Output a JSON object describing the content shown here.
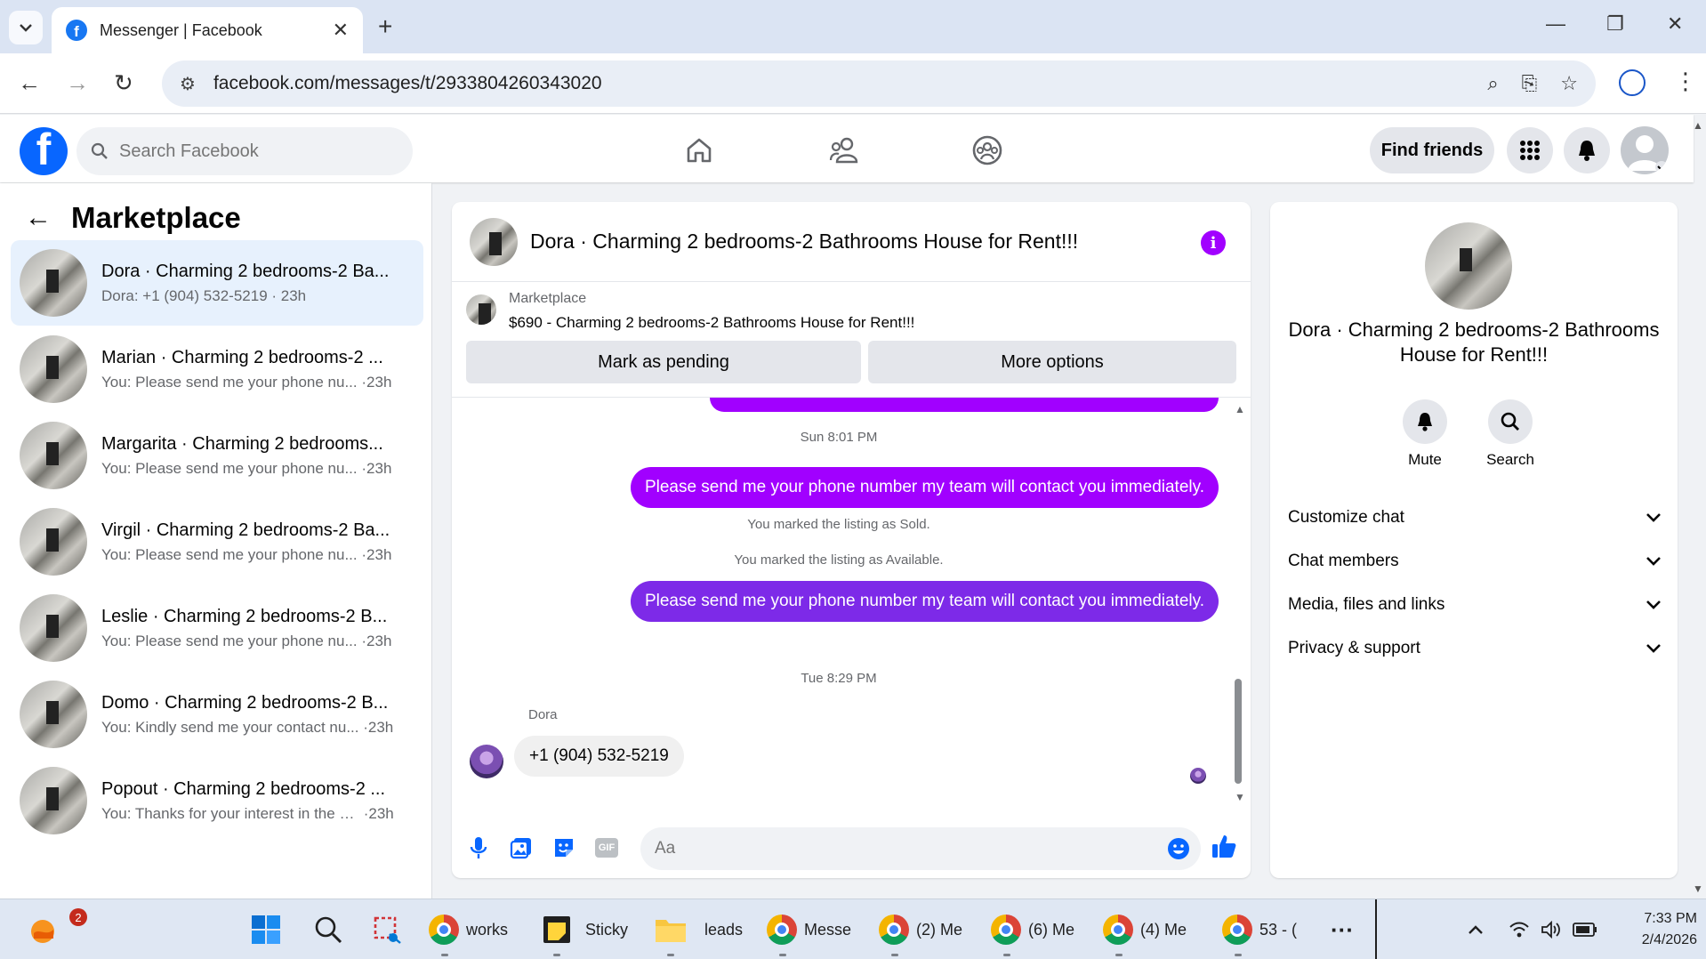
{
  "browser": {
    "tab_title": "Messenger | Facebook",
    "url": "facebook.com/messages/t/2933804260343020"
  },
  "fb_header": {
    "search_placeholder": "Search Facebook",
    "find_friends_label": "Find friends"
  },
  "sidebar": {
    "title": "Marketplace",
    "conversations": [
      {
        "name": "Dora · Charming 2 bedrooms-2 Ba...",
        "snippet": "Dora: +1 (904) 532-5219",
        "time": "23h",
        "active": true
      },
      {
        "name": "Marian · Charming 2 bedrooms-2 ...",
        "snippet": "You: Please send me your phone nu...",
        "time": "23h"
      },
      {
        "name": "Margarita · Charming 2 bedrooms...",
        "snippet": "You: Please send me your phone nu...",
        "time": "23h"
      },
      {
        "name": "Virgil · Charming 2 bedrooms-2 Ba...",
        "snippet": "You: Please send me your phone nu...",
        "time": "23h"
      },
      {
        "name": "Leslie · Charming 2 bedrooms-2 B...",
        "snippet": "You: Please send me your phone nu...",
        "time": "23h"
      },
      {
        "name": "Domo · Charming 2 bedrooms-2 B...",
        "snippet": "You: Kindly send me your contact nu...",
        "time": "23h"
      },
      {
        "name": "Popout · Charming 2 bedrooms-2 ...",
        "snippet": "You: Thanks for your interest in the h...",
        "time": "23h"
      }
    ]
  },
  "chat": {
    "title": "Dora · Charming 2 bedrooms-2 Bathrooms House for Rent!!!",
    "listing_label": "Marketplace",
    "listing_title": "$690 - Charming 2 bedrooms-2 Bathrooms House for Rent!!!",
    "mark_pending_label": "Mark as pending",
    "more_options_label": "More options",
    "time1": "Sun 8:01 PM",
    "msg1": "Please send me your phone number my team will contact you immediately.",
    "sys1": "You marked the listing as Sold.",
    "sys2": "You marked the listing as Available.",
    "msg2": "Please send me your phone number my team will contact you immediately.",
    "time2": "Tue 8:29 PM",
    "sender": "Dora",
    "msg3": "+1 (904) 532-5219",
    "composer_placeholder": "Aa",
    "gif_label": "GIF"
  },
  "info_panel": {
    "title": "Dora · Charming 2 bedrooms-2 Bathrooms House for Rent!!!",
    "mute_label": "Mute",
    "search_label": "Search",
    "sections": [
      "Customize chat",
      "Chat members",
      "Media, files and links",
      "Privacy & support"
    ]
  },
  "taskbar": {
    "notif_badge": "2",
    "items": [
      "works",
      "Sticky",
      "leads",
      "Messe",
      "(2) Me",
      "(6) Me",
      "(4) Me",
      "53 - ("
    ],
    "time": "7:33 PM",
    "date": "2/4/2026"
  },
  "colors": {
    "fb_blue": "#0866ff",
    "bubble_purple": "#a100ff",
    "bubble_violet": "#7d2ae8",
    "active_row": "#e7f1fd"
  }
}
